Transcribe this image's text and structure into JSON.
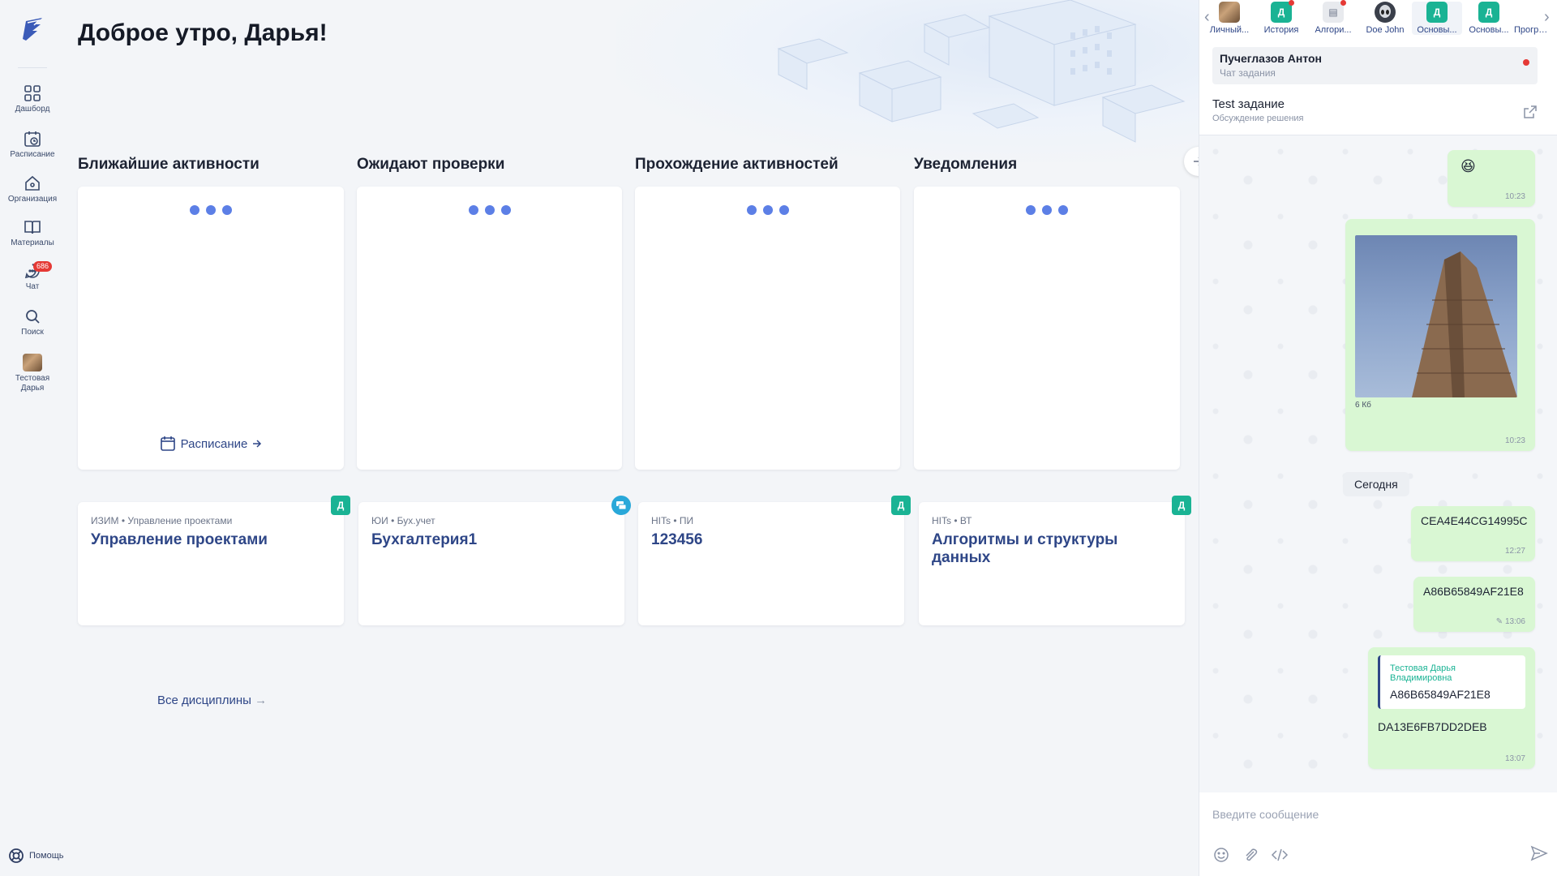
{
  "greeting": "Доброе утро, Дарья!",
  "sidebar": {
    "items": [
      {
        "label": "Дашборд",
        "icon": "grid-icon"
      },
      {
        "label": "Расписание",
        "icon": "calendar-clock-icon"
      },
      {
        "label": "Организация",
        "icon": "home-icon"
      },
      {
        "label": "Материалы",
        "icon": "book-icon"
      },
      {
        "label": "Чат",
        "icon": "chat-icon",
        "badge": "686"
      },
      {
        "label": "Поиск",
        "icon": "search-icon"
      },
      {
        "label": "Тестовая Дарья",
        "icon": "avatar"
      }
    ],
    "help": "Помощь"
  },
  "columns": [
    {
      "title": "Ближайшие активности"
    },
    {
      "title": "Ожидают проверки"
    },
    {
      "title": "Прохождение активностей"
    },
    {
      "title": "Уведомления"
    }
  ],
  "schedule_link": "Расписание",
  "disciplines": [
    {
      "meta": "ИЗИМ • Управление проектами",
      "name": "Управление проектами",
      "tag": "Д"
    },
    {
      "meta": "ЮИ • Бух.учет",
      "name": "Бухгалтерия1",
      "tag": ""
    },
    {
      "meta": "HITs • ПИ",
      "name": "123456",
      "tag": "Д"
    },
    {
      "meta": "HITs • ВТ",
      "name": "Алгоритмы и структуры данных",
      "tag": "Д"
    }
  ],
  "all_disciplines": "Все дисциплины",
  "chat": {
    "tabs": [
      {
        "label": "Личный...",
        "type": "avatar"
      },
      {
        "label": "История",
        "tag": "Д",
        "unread": true
      },
      {
        "label": "Алгори...",
        "type": "doc",
        "unread": true
      },
      {
        "label": "Doe John",
        "type": "alien"
      },
      {
        "label": "Основы...",
        "tag": "Д",
        "active": true
      },
      {
        "label": "Основы...",
        "tag": "Д"
      },
      {
        "label": "Програ..."
      }
    ],
    "thread1": {
      "title": "Пучеглазов Антон",
      "subtitle": "Чат задания"
    },
    "thread2": {
      "title": "Test задание",
      "subtitle": "Обсуждение решения"
    },
    "messages": [
      {
        "text": "😆",
        "time": "10:23"
      },
      {
        "file_size": "6 Кб",
        "time": "10:23"
      },
      {
        "text": "CEA4E44CG14995C",
        "time": "12:27"
      },
      {
        "text": "A86B65849AF21E8",
        "time": "13:06"
      },
      {
        "quote_author": "Тестовая Дарья Владимировна",
        "quote_text": "A86B65849AF21E8",
        "text": "DA13E6FB7DD2DEB",
        "time": "13:07"
      }
    ],
    "date_divider": "Сегодня",
    "input_placeholder": "Введите сообщение"
  },
  "colors": {
    "accent": "#2e4687",
    "green": "#1ab394",
    "dots": "#5c7fe6",
    "bubble": "#d9f7d3",
    "badge": "#e53935"
  }
}
